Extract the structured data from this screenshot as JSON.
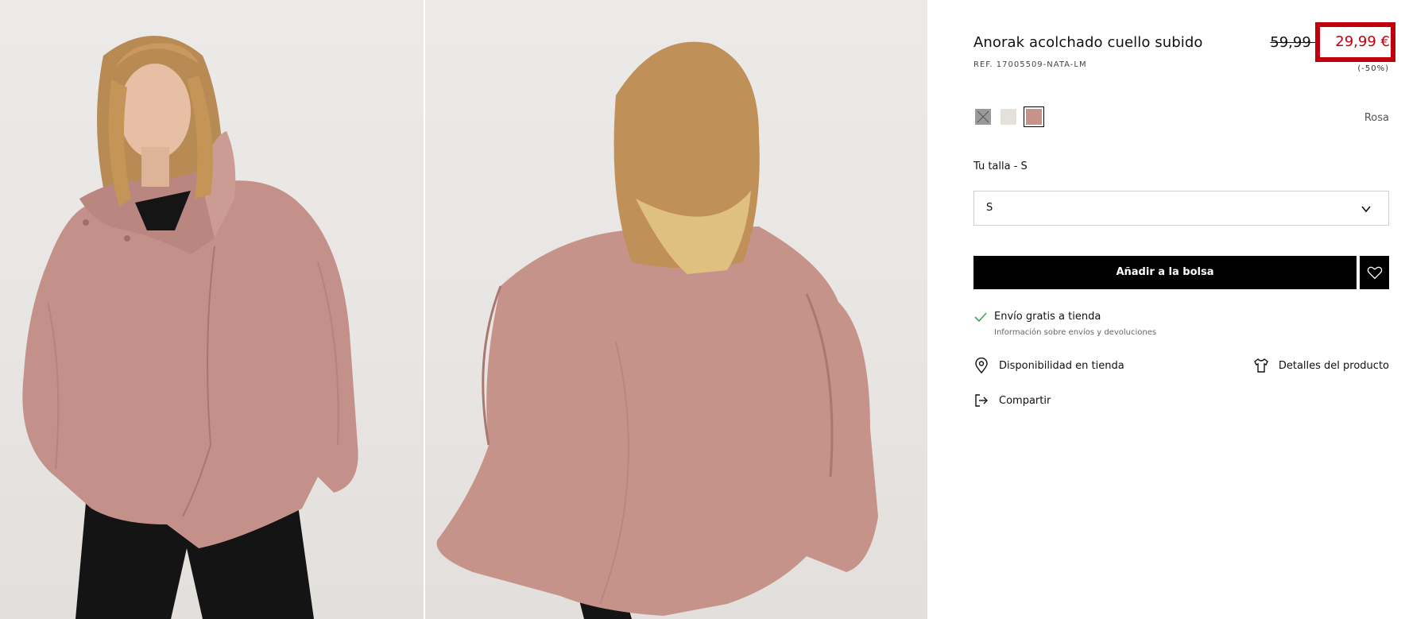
{
  "product": {
    "title": "Anorak acolchado cuello subido",
    "ref": "REF. 17005509-NATA-LM",
    "price_old": "59,99 €",
    "price_new": "29,99 €",
    "discount": "(-50%)"
  },
  "colors": {
    "selected_name": "Rosa",
    "swatches": [
      {
        "name": "gris",
        "hex": "#9a9a98",
        "crossed": true
      },
      {
        "name": "crudo",
        "hex": "#e3e1da",
        "crossed": false
      },
      {
        "name": "rosa",
        "hex": "#c6938a",
        "crossed": false,
        "selected": true
      }
    ]
  },
  "size": {
    "label": "Tu talla - S",
    "selected": "S"
  },
  "actions": {
    "add_to_bag": "Añadir a la bolsa",
    "wishlist_icon": "heart-icon"
  },
  "shipping": {
    "title": "Envío gratis a tienda",
    "info": "Información sobre envíos y devoluciones"
  },
  "links": {
    "store": "Disponibilidad en tienda",
    "details": "Detalles del producto",
    "share": "Compartir"
  },
  "accent": {
    "sale_red": "#c0000c",
    "check_green": "#3aa45a"
  }
}
